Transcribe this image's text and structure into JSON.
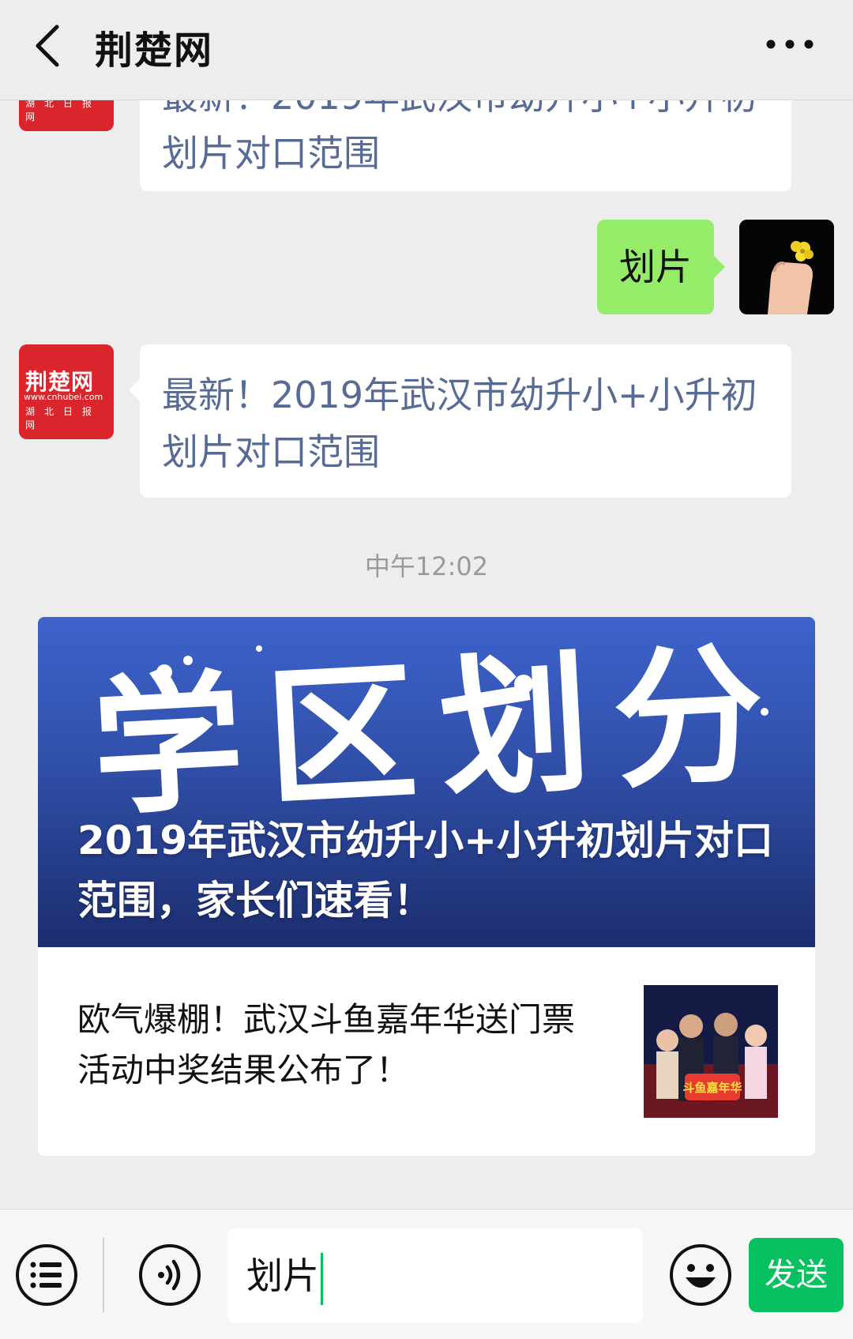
{
  "header": {
    "title": "荆楚网"
  },
  "messages": {
    "first_article_link": "最新！2019年武汉市幼升小+小升初划片对口范围",
    "user_message": "划片",
    "second_article_link": "最新！2019年武汉市幼升小+小升初划片对口范围",
    "timestamp": "中午12:02"
  },
  "logo": {
    "name": "荆楚网",
    "url": "www.cnhubei.com",
    "slogan": "湖北日报网"
  },
  "card": {
    "banner_art_text": "学区划分",
    "banner_title": "2019年武汉市幼升小+小升初划片对口范围，家长们速看！",
    "sub_title": "欧气爆棚！武汉斗鱼嘉年华送门票活动中奖结果公布了！",
    "thumb_text": "斗鱼嘉年华"
  },
  "input": {
    "value": "划片",
    "send_label": "发送"
  },
  "colors": {
    "send_green": "#07c160",
    "bubble_green": "#95ec69",
    "link_blue": "#576b95",
    "brand_red": "#d9252b"
  }
}
